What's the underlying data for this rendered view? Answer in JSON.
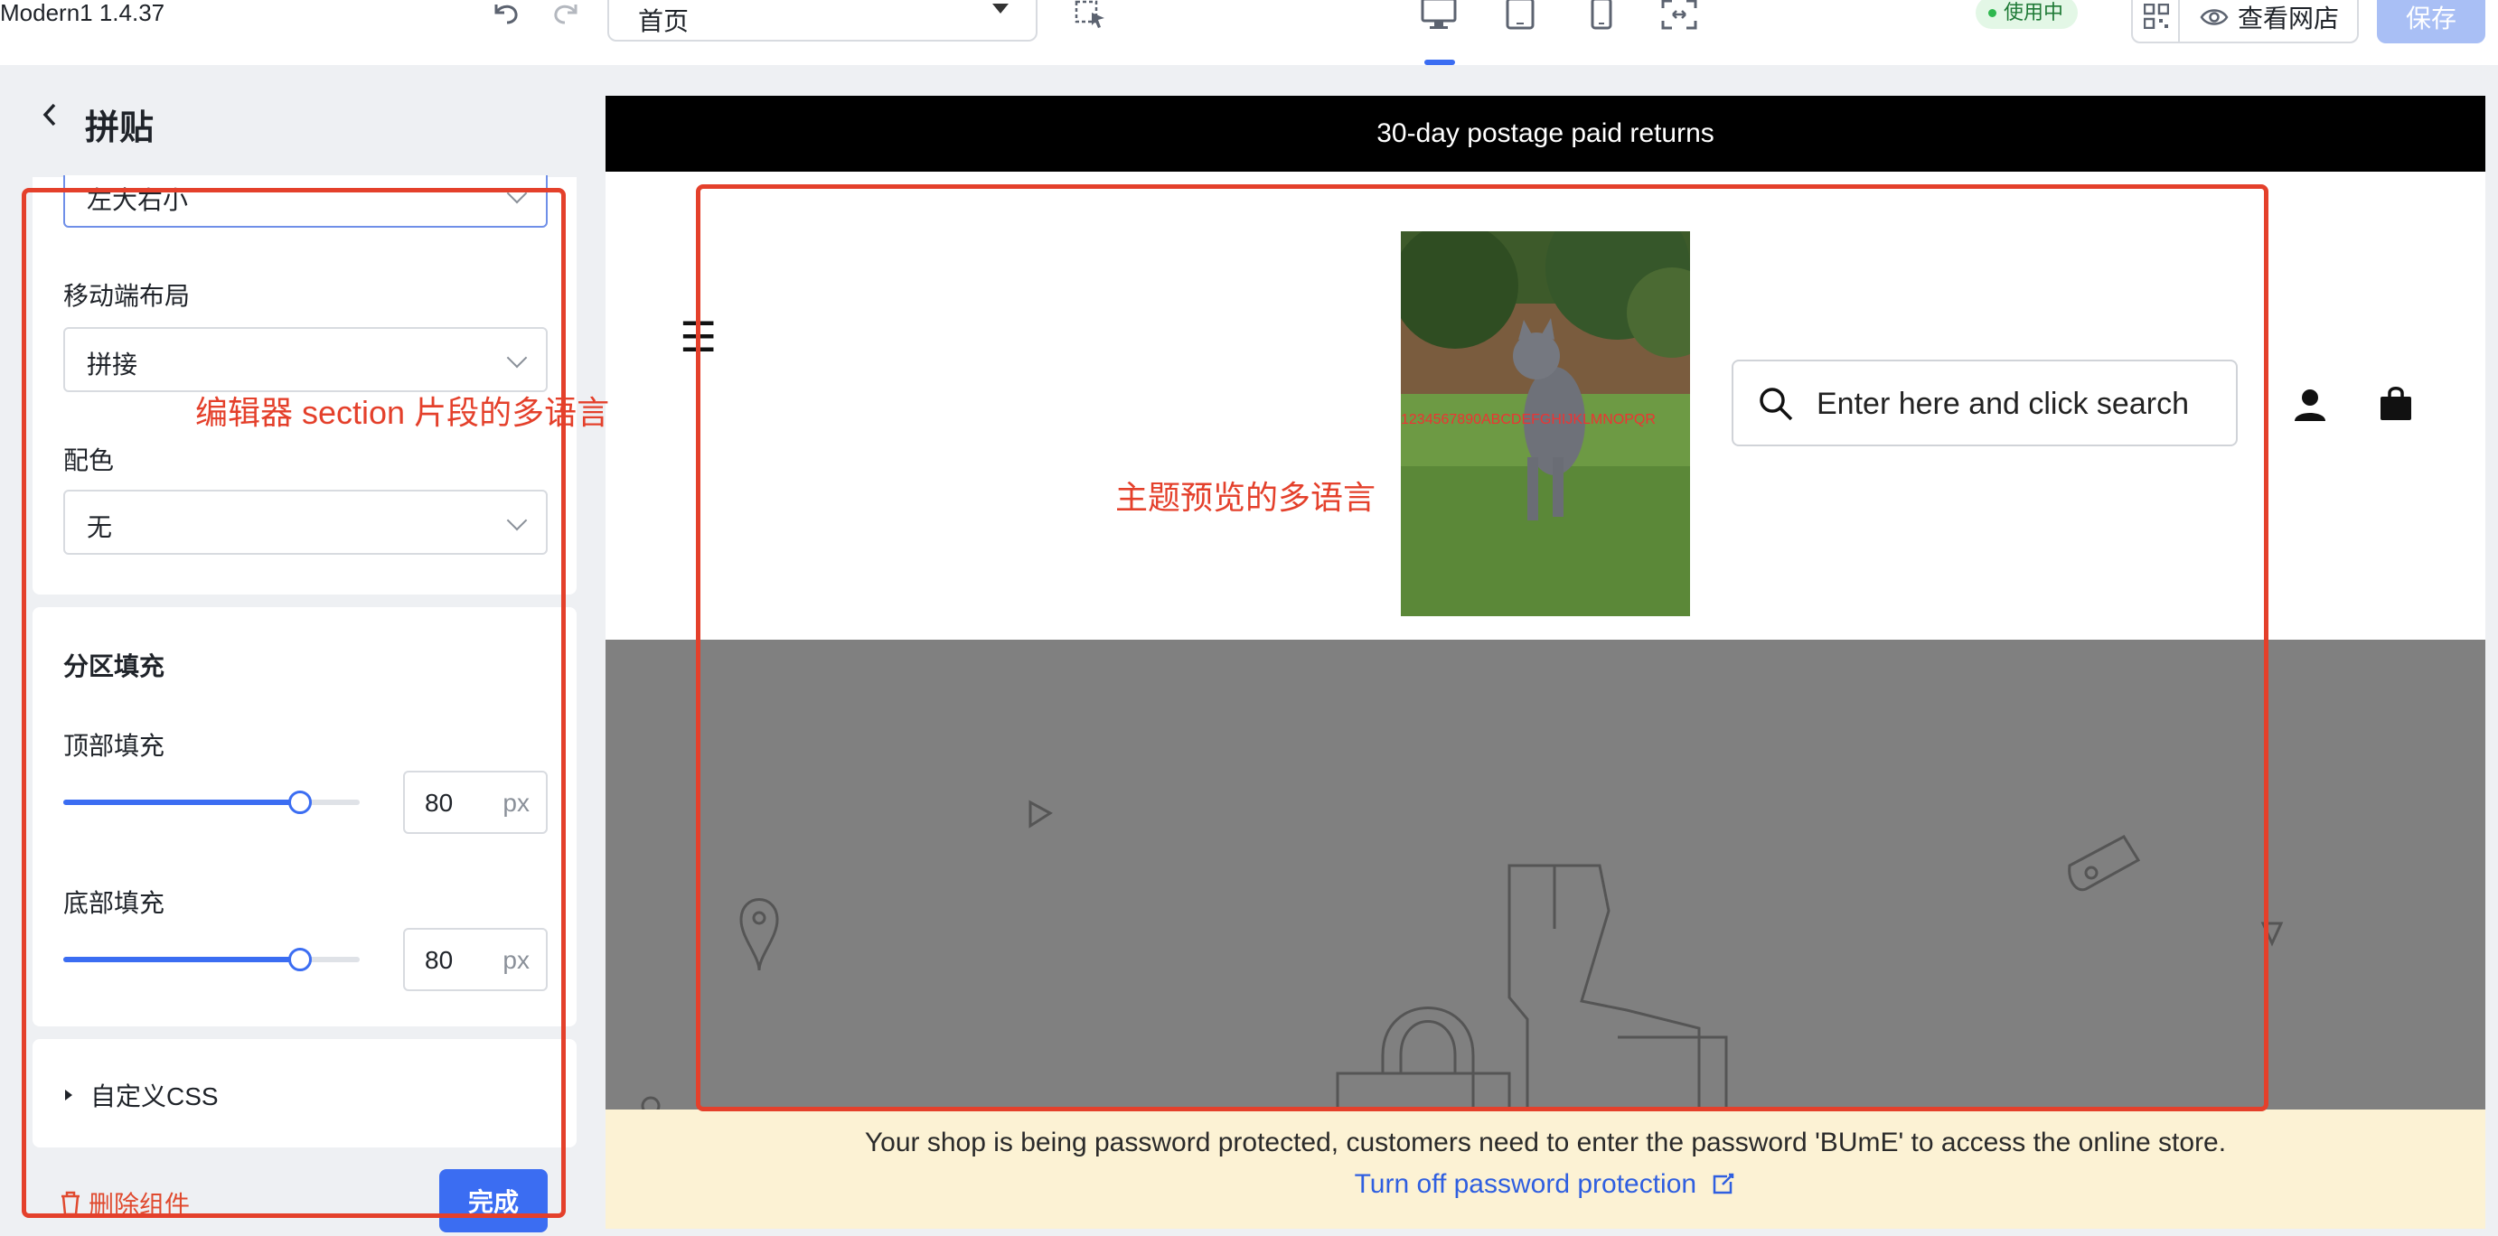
{
  "app": {
    "title": "Modern1 1.4.37"
  },
  "toolbar": {
    "page_select_value": "首页",
    "status_badge": "使用中",
    "view_store_label": "查看网店",
    "save_label": "保存"
  },
  "panel": {
    "title": "拼贴",
    "desktop_layout_value": "左大右小",
    "mobile_layout_label": "移动端布局",
    "mobile_layout_value": "拼接",
    "color_label": "配色",
    "color_value": "无",
    "padding_section_title": "分区填充",
    "top_padding_label": "顶部填充",
    "top_padding_value": "80",
    "top_padding_fraction": 0.8,
    "bottom_padding_label": "底部填充",
    "bottom_padding_value": "80",
    "bottom_padding_fraction": 0.8,
    "unit": "px",
    "custom_css_label": "自定义CSS",
    "delete_label": "删除组件",
    "done_label": "完成"
  },
  "preview": {
    "announcement": "30-day postage paid returns",
    "search_placeholder": "Enter here and click search",
    "logo_overlay_text": "1234567890ABCDEFGHIJKLMNOPQR",
    "password_notice": "Your shop is being password protected, customers need to enter the password 'BUmE' to access the online store.",
    "password_link": "Turn off password protection"
  },
  "annotations": {
    "editor": "编辑器 section 片段的多语言",
    "preview": "主题预览的多语言"
  },
  "colors": {
    "accent": "#3b6df2",
    "annotation": "#e4402b",
    "save_disabled": "#a9bff5",
    "hero_gray": "#808080",
    "notice_bg": "#fcf2d4"
  }
}
